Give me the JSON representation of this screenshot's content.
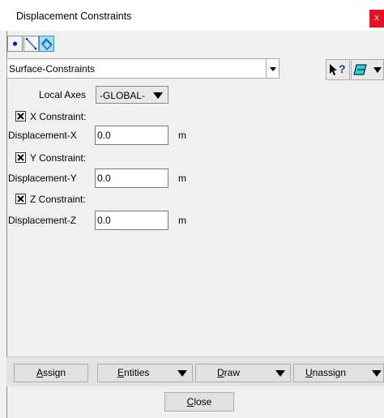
{
  "window": {
    "title": "Displacement Constraints",
    "close_glyph": "x"
  },
  "toolbar": {
    "geometry_buttons": [
      {
        "icon": "point-icon"
      },
      {
        "icon": "line-icon"
      },
      {
        "icon": "surface-icon",
        "active": true
      }
    ],
    "condition_combo": {
      "value": "Surface-Constraints"
    },
    "help_glyph": "?"
  },
  "form": {
    "local_axes_label": "Local Axes",
    "local_axes_value": "-GLOBAL-",
    "constraints": [
      {
        "checkbox_label": "X Constraint:",
        "checked": true,
        "field_label": "Displacement-X",
        "value": "0.0",
        "unit": "m"
      },
      {
        "checkbox_label": "Y Constraint:",
        "checked": true,
        "field_label": "Displacement-Y",
        "value": "0.0",
        "unit": "m"
      },
      {
        "checkbox_label": "Z Constraint:",
        "checked": true,
        "field_label": "Displacement-Z",
        "value": "0.0",
        "unit": "m"
      }
    ]
  },
  "buttons": {
    "assign": {
      "first": "A",
      "rest": "ssign"
    },
    "entities": {
      "first": "E",
      "rest": "ntities"
    },
    "draw": {
      "first": "D",
      "rest": "raw"
    },
    "unassign": {
      "first": "U",
      "rest": "nassign"
    },
    "close": {
      "first": "C",
      "rest": "lose"
    }
  }
}
